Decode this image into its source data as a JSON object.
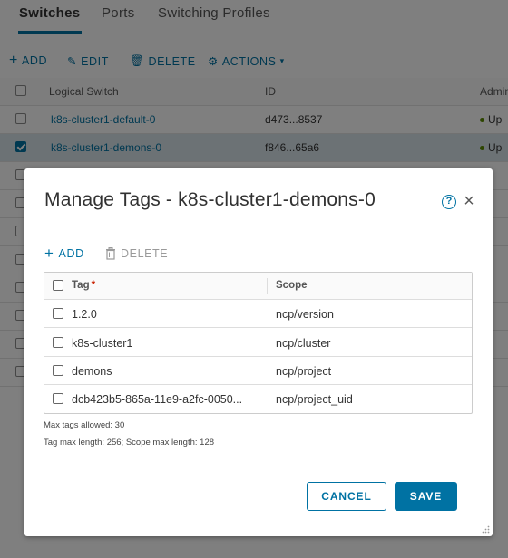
{
  "background": {
    "tabs": [
      {
        "label": "Switches",
        "active": true
      },
      {
        "label": "Ports",
        "active": false
      },
      {
        "label": "Switching Profiles",
        "active": false
      }
    ],
    "toolbar": {
      "add": "ADD",
      "edit": "EDIT",
      "delete": "DELETE",
      "actions": "ACTIONS"
    },
    "grid": {
      "columns": [
        "Logical Switch",
        "ID",
        "Admin"
      ],
      "rows": [
        {
          "name": "k8s-cluster1-default-0",
          "id": "d473...8537",
          "admin": "Up",
          "checked": false
        },
        {
          "name": "k8s-cluster1-demons-0",
          "id": "f846...65a6",
          "admin": "Up",
          "checked": true
        }
      ]
    }
  },
  "modal": {
    "title": "Manage Tags - k8s-cluster1-demons-0",
    "help_icon": "?",
    "close_icon": "×",
    "toolbar": {
      "add": "ADD",
      "delete": "DELETE"
    },
    "table": {
      "header": {
        "tag": "Tag",
        "required_mark": "*",
        "scope": "Scope"
      },
      "rows": [
        {
          "tag": "1.2.0",
          "scope": "ncp/version"
        },
        {
          "tag": "k8s-cluster1",
          "scope": "ncp/cluster"
        },
        {
          "tag": "demons",
          "scope": "ncp/project"
        },
        {
          "tag": "dcb423b5-865a-11e9-a2fc-0050...",
          "scope": "ncp/project_uid"
        }
      ]
    },
    "notes": {
      "max_tags": "Max tags allowed: 30",
      "lengths": "Tag max length: 256; Scope max length: 128"
    },
    "buttons": {
      "cancel": "CANCEL",
      "save": "SAVE"
    }
  },
  "colors": {
    "accent": "#0072a3",
    "required": "#c92100",
    "overlay": "rgba(0,0,0,0.5)"
  }
}
